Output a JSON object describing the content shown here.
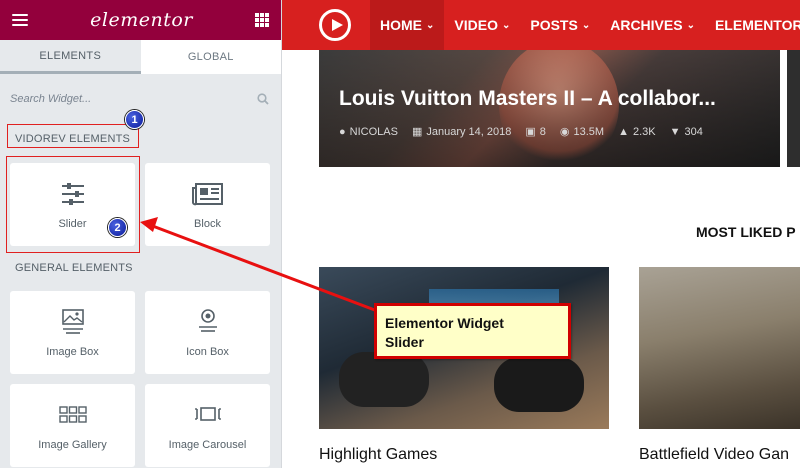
{
  "panel": {
    "logo": "elementor",
    "tabs": [
      {
        "label": "ELEMENTS"
      },
      {
        "label": "GLOBAL"
      }
    ],
    "search_placeholder": "Search Widget...",
    "categories": [
      {
        "title": "VIDOREV ELEMENTS",
        "widgets": [
          {
            "label": "Slider",
            "icon": "sliders-icon"
          },
          {
            "label": "Block",
            "icon": "newspaper-icon"
          }
        ]
      },
      {
        "title": "GENERAL ELEMENTS",
        "widgets": [
          {
            "label": "Image Box",
            "icon": "image-box-icon"
          },
          {
            "label": "Icon Box",
            "icon": "icon-box-icon"
          },
          {
            "label": "Image Gallery",
            "icon": "gallery-grid-icon"
          },
          {
            "label": "Image Carousel",
            "icon": "carousel-icon"
          }
        ]
      }
    ],
    "colors": {
      "header": "#93003c",
      "panel_bg": "#e6e9ec"
    }
  },
  "annotations": {
    "badge_1": "1",
    "badge_2": "2",
    "callout_line1": "Elementor Widget",
    "callout_line2": "Slider"
  },
  "site": {
    "nav": [
      {
        "label": "HOME",
        "active": true
      },
      {
        "label": "VIDEO"
      },
      {
        "label": "POSTS"
      },
      {
        "label": "ARCHIVES"
      },
      {
        "label": "ELEMENTOR"
      }
    ],
    "hero": {
      "title": "Louis Vuitton Masters II – A collabor...",
      "author": "NICOLAS",
      "date": "January 14, 2018",
      "comments": "8",
      "views": "13.5M",
      "likes": "2.3K",
      "dislikes": "304"
    },
    "section_title": "MOST LIKED P",
    "cards": [
      {
        "title": "Highlight Games"
      },
      {
        "title": "Battlefield Video Gan"
      }
    ],
    "colors": {
      "nav": "#d7201f"
    }
  }
}
